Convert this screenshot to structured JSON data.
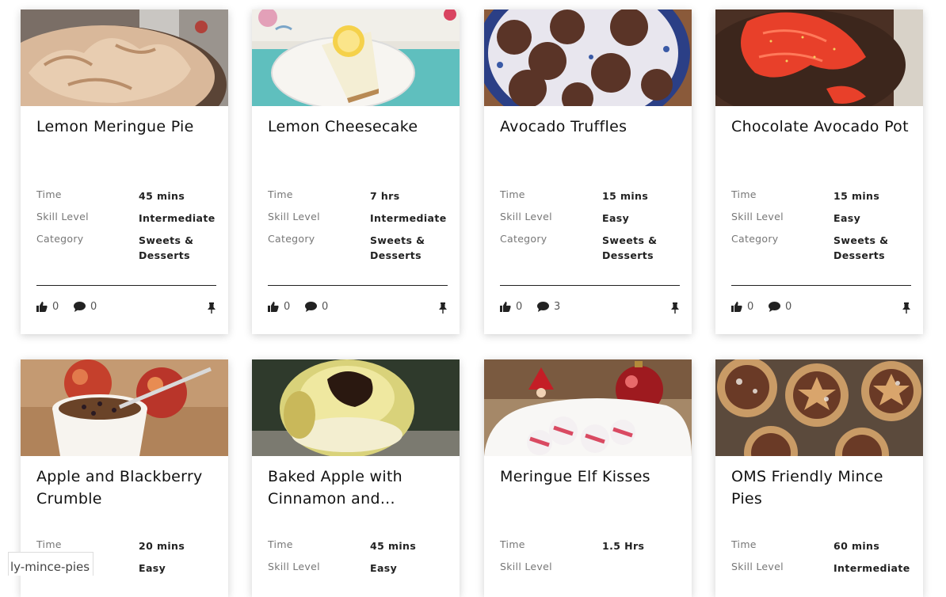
{
  "labels": {
    "time": "Time",
    "skill": "Skill Level",
    "category": "Category"
  },
  "status_url_fragment": "ly-mince-pies",
  "recipes": [
    {
      "title": "Lemon Meringue Pie",
      "time": "45 mins",
      "skill": "Intermediate",
      "category": "Sweets & Desserts",
      "likes": "0",
      "comments": "0"
    },
    {
      "title": "Lemon Cheesecake",
      "time": "7 hrs",
      "skill": "Intermediate",
      "category": "Sweets & Desserts",
      "likes": "0",
      "comments": "0"
    },
    {
      "title": "Avocado Truffles",
      "time": "15 mins",
      "skill": "Easy",
      "category": "Sweets & Desserts",
      "likes": "0",
      "comments": "3"
    },
    {
      "title": "Chocolate Avocado Pot",
      "time": "15 mins",
      "skill": "Easy",
      "category": "Sweets & Desserts",
      "likes": "0",
      "comments": "0"
    },
    {
      "title": "Apple and Blackberry Crumble",
      "time": "20 mins",
      "skill": "Easy"
    },
    {
      "title": "Baked Apple with Cinnamon and...",
      "time": "45 mins",
      "skill": "Easy"
    },
    {
      "title": "Meringue Elf Kisses",
      "time": "1.5 Hrs",
      "skill": ""
    },
    {
      "title": "OMS Friendly Mince Pies",
      "time": "60 mins",
      "skill": "Intermediate"
    }
  ]
}
